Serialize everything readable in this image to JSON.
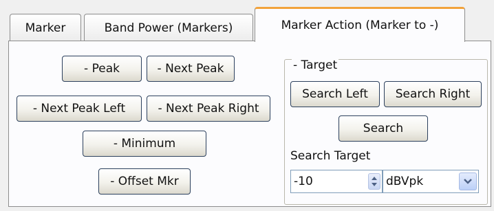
{
  "tabs": [
    {
      "label": "Marker"
    },
    {
      "label": "Band Power (Markers)"
    },
    {
      "label": "Marker Action (Marker to -)"
    }
  ],
  "actions": {
    "peak": "- Peak",
    "next_peak": "- Next Peak",
    "next_peak_left": "- Next Peak Left",
    "next_peak_right": "- Next Peak Right",
    "minimum": "- Minimum",
    "offset_mkr": "- Offset Mkr"
  },
  "target": {
    "title": "- Target",
    "search_left": "Search Left",
    "search_right": "Search Right",
    "search": "Search",
    "search_target_label": "Search Target",
    "search_target_value": "-10",
    "unit_selected": "dBVpk"
  },
  "colors": {
    "active_tab_accent": "#f2a23a",
    "button_border": "#2b3f5c",
    "field_border": "#7f9db9"
  },
  "icons": {
    "spinner": "spinner-arrows-icon",
    "dropdown": "chevron-down-icon"
  }
}
